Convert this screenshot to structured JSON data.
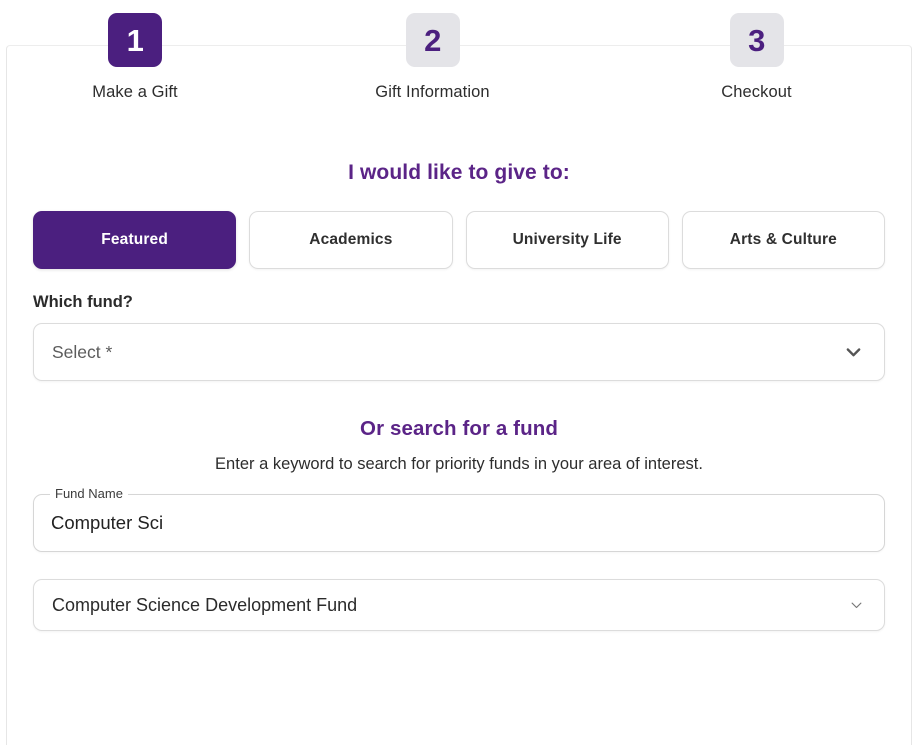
{
  "stepper": {
    "steps": [
      {
        "number": "1",
        "label": "Make a Gift",
        "state": "active"
      },
      {
        "number": "2",
        "label": "Gift Information",
        "state": "inactive"
      },
      {
        "number": "3",
        "label": "Checkout",
        "state": "inactive"
      }
    ]
  },
  "give_section": {
    "heading": "I would like to give to:",
    "tabs": [
      {
        "label": "Featured",
        "selected": true
      },
      {
        "label": "Academics",
        "selected": false
      },
      {
        "label": "University Life",
        "selected": false
      },
      {
        "label": "Arts & Culture",
        "selected": false
      }
    ]
  },
  "fund_select": {
    "label": "Which fund?",
    "value": "Select *",
    "icon": "chevron-down-icon"
  },
  "search_section": {
    "heading": "Or search for a fund",
    "subtext": "Enter a keyword to search for priority funds in your area of interest.",
    "fund_name_label": "Fund Name",
    "fund_name_value": "Computer Sci",
    "fund_name_placeholder": "",
    "result_value": "Computer Science Development Fund",
    "result_icon": "chevron-down-icon"
  },
  "colors": {
    "brand_purple": "#4B1F7F",
    "heading_purple": "#5B2487",
    "badge_inactive_bg": "#E4E4E8",
    "border_gray": "#DCDCDC",
    "text_dark": "#2B2B2B"
  }
}
